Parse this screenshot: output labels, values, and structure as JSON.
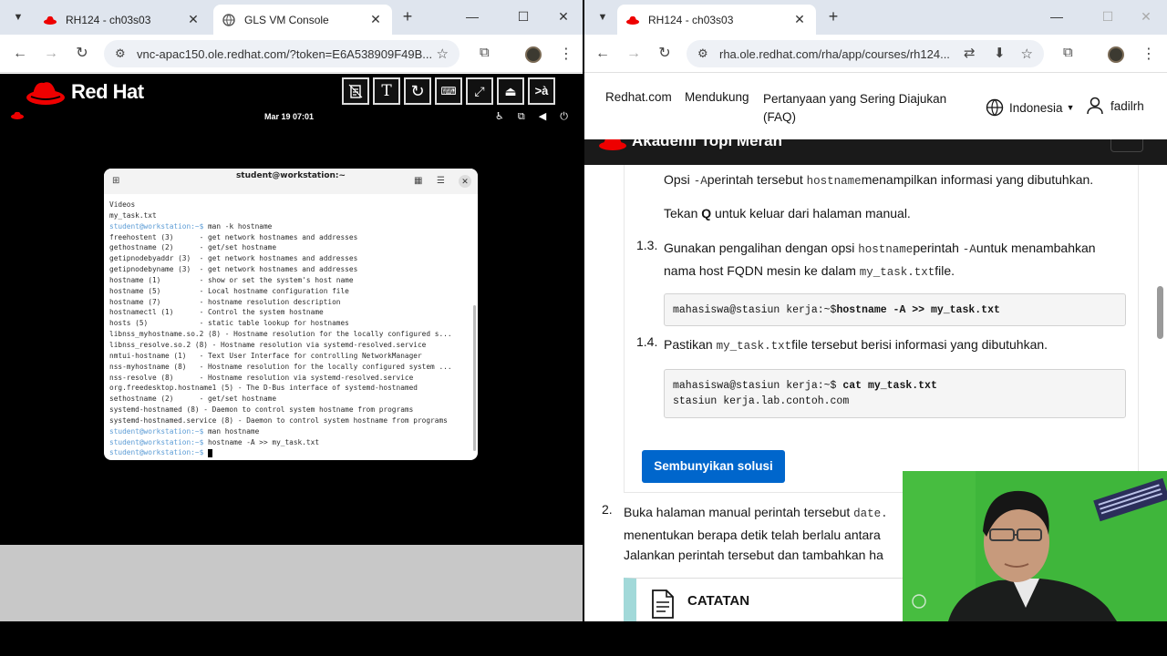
{
  "left_window": {
    "tabs": [
      {
        "title": "RH124 - ch03s03",
        "active": false
      },
      {
        "title": "GLS VM Console",
        "active": true
      }
    ],
    "url": "vnc-apac150.ole.redhat.com/?token=E6A538909F49B..."
  },
  "vnc": {
    "brand": "Red Hat",
    "tools": [
      "clipboard",
      "T",
      "refresh",
      "keyboard",
      "fullscreen-off",
      "person",
      ">à"
    ],
    "clock": "Mar 19  07:01",
    "terminal": {
      "title": "student@workstation:~",
      "lines": [
        {
          "text": "Videos"
        },
        {
          "text": "my_task.txt"
        },
        {
          "prompt": "student@workstation:~$ ",
          "text": "man -k hostname"
        },
        {
          "text": "freehostent (3)      - get network hostnames and addresses"
        },
        {
          "text": "gethostname (2)      - get/set hostname"
        },
        {
          "text": "getipnodebyaddr (3)  - get network hostnames and addresses"
        },
        {
          "text": "getipnodebyname (3)  - get network hostnames and addresses"
        },
        {
          "text": "hostname (1)         - show or set the system's host name"
        },
        {
          "text": "hostname (5)         - Local hostname configuration file"
        },
        {
          "text": "hostname (7)         - hostname resolution description"
        },
        {
          "text": "hostnamectl (1)      - Control the system hostname"
        },
        {
          "text": "hosts (5)            - static table lookup for hostnames"
        },
        {
          "text": "libnss_myhostname.so.2 (8) - Hostname resolution for the locally configured s..."
        },
        {
          "text": "libnss_resolve.so.2 (8) - Hostname resolution via systemd-resolved.service"
        },
        {
          "text": "nmtui-hostname (1)   - Text User Interface for controlling NetworkManager"
        },
        {
          "text": "nss-myhostname (8)   - Hostname resolution for the locally configured system ..."
        },
        {
          "text": "nss-resolve (8)      - Hostname resolution via systemd-resolved.service"
        },
        {
          "text": "org.freedesktop.hostname1 (5) - The D-Bus interface of systemd-hostnamed"
        },
        {
          "text": "sethostname (2)      - get/set hostname"
        },
        {
          "text": "systemd-hostnamed (8) - Daemon to control system hostname from programs"
        },
        {
          "text": "systemd-hostnamed.service (8) - Daemon to control system hostname from programs"
        },
        {
          "prompt": "student@workstation:~$ ",
          "text": "man hostname"
        },
        {
          "prompt": "student@workstation:~$ ",
          "text": "hostname -A >> my_task.txt"
        },
        {
          "prompt": "student@workstation:~$ ",
          "text": "",
          "cursor": true
        }
      ]
    }
  },
  "right_window": {
    "tabs": [
      {
        "title": "RH124 - ch03s03",
        "active": true
      }
    ],
    "url": "rha.ole.redhat.com/rha/app/courses/rh124...",
    "nav": {
      "links": [
        "Redhat.com",
        "Mendukung",
        "Pertanyaan yang Sering Diajukan (FAQ)"
      ],
      "faq_line1": "Pertanyaan yang Sering Diajukan",
      "faq_line2": "(FAQ)",
      "language": "Indonesia",
      "user": "fadilrh"
    },
    "band_brand": "Akademi Topi Merah",
    "content": {
      "p1_a": "Opsi ",
      "p1_b": "-A",
      "p1_c": "perintah tersebut ",
      "p1_d": "hostname",
      "p1_e": "menampilkan informasi yang dibutuhkan.",
      "p2_a": "Tekan ",
      "p2_b": "Q",
      "p2_c": " untuk keluar dari halaman manual.",
      "s13_num": "1.3.",
      "s13_a": "Gunakan pengalihan dengan opsi ",
      "s13_b": "hostname",
      "s13_c": "perintah ",
      "s13_d": "-A",
      "s13_e": "untuk menambahkan nama host FQDN mesin ke dalam ",
      "s13_f": "my_task.txt",
      "s13_g": "file.",
      "code1_prompt": "mahasiswa@stasiun kerja:~$",
      "code1_cmd": "hostname -A >> my_task.txt",
      "s14_num": "1.4.",
      "s14_a": "Pastikan ",
      "s14_b": "my_task.txt",
      "s14_c": "file tersebut berisi informasi yang dibutuhkan.",
      "code2_prompt": "mahasiswa@stasiun kerja:~$ ",
      "code2_cmd": "cat my_task.txt",
      "code2_out": "stasiun kerja.lab.contoh.com",
      "hide_solution": "Sembunyikan solusi",
      "s2_num": "2.",
      "s2_line1_a": "Buka halaman manual perintah tersebut ",
      "s2_line1_b": "date.",
      "s2_line2": "menentukan berapa detik telah berlalu antara",
      "s2_line3": "Jalankan perintah tersebut dan tambahkan ha",
      "note_label": "CATATAN"
    }
  },
  "colors": {
    "redhat_red": "#ee0000",
    "button_blue": "#0066cc",
    "note_accent": "#a2d9d9",
    "prompt_blue": "#5a9bd5"
  }
}
